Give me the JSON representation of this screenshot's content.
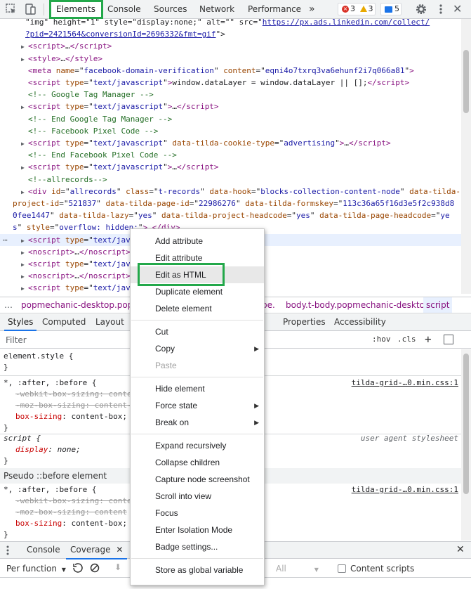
{
  "toolbar": {
    "tabs": [
      {
        "label": "Elements",
        "active": true
      },
      {
        "label": "Console"
      },
      {
        "label": "Sources"
      },
      {
        "label": "Network"
      },
      {
        "label": "Performance"
      }
    ],
    "more_tabs": "»",
    "errors": "3",
    "warnings": "3",
    "messages": "5",
    "icons": [
      "inspect-icon",
      "device-toolbar-icon",
      "settings-gear-icon",
      "more-vertical-icon"
    ]
  },
  "dom": {
    "lines": [
      {
        "html": "<span class='txt'>  \"img\" height=\"1\" style=\"display:none;\" alt=\"\" src=\"</span><span class='link'>https://px.ads.linkedin.com/collect/</span>"
      },
      {
        "html": "<span class='link'>?pid=2421564&amp;conversionId=2696332&amp;fmt=gif</span><span class='txt'>\"&gt;</span>"
      },
      {
        "html": "<span class='arrow'>▶</span><span class='tag'>&lt;script&gt;</span>…<span class='tag'>&lt;/script&gt;</span>"
      },
      {
        "html": "<span class='arrow'>▶</span><span class='tag'>&lt;style&gt;</span>…<span class='tag'>&lt;/style&gt;</span>"
      },
      {
        "html": "<span class='arrow'></span><span class='tag'>&lt;meta</span> <span class='attr'>name</span>=\"<span class='val'>facebook-domain-verification</span>\" <span class='attr'>content</span>=\"<span class='val'>eqni4o7txrq3va6ehunf2i7q066a81</span>\"<span class='tag'>&gt;</span>"
      },
      {
        "html": "<span class='arrow'></span><span class='tag'>&lt;script</span> <span class='attr'>type</span>=\"<span class='val'>text/javascript</span>\"<span class='tag'>&gt;</span>window.dataLayer = window.dataLayer || [];<span class='tag'>&lt;/script&gt;</span>"
      },
      {
        "html": "<span class='arrow'></span><span class='cmt'>&lt;!-- Google Tag Manager --&gt;</span>"
      },
      {
        "html": "<span class='arrow'>▶</span><span class='tag'>&lt;script</span> <span class='attr'>type</span>=\"<span class='val'>text/javascript</span>\"<span class='tag'>&gt;</span>…<span class='tag'>&lt;/script&gt;</span>"
      },
      {
        "html": "<span class='arrow'></span><span class='cmt'>&lt;!-- End Google Tag Manager --&gt;</span>"
      },
      {
        "html": "<span class='arrow'></span><span class='cmt'>&lt;!-- Facebook Pixel Code --&gt;</span>"
      },
      {
        "html": "<span class='arrow'>▶</span><span class='tag'>&lt;script</span> <span class='attr'>type</span>=\"<span class='val'>text/javascript</span>\" <span class='attr'>data-tilda-cookie-type</span>=\"<span class='val'>advertising</span>\"<span class='tag'>&gt;</span>…<span class='tag'>&lt;/script&gt;</span>"
      },
      {
        "html": "<span class='arrow'></span><span class='cmt'>&lt;!-- End Facebook Pixel Code --&gt;</span>"
      },
      {
        "html": "<span class='arrow'>▶</span><span class='tag'>&lt;script</span> <span class='attr'>type</span>=\"<span class='val'>text/javascript</span>\"<span class='tag'>&gt;</span>…<span class='tag'>&lt;/script&gt;</span>"
      },
      {
        "html": "<span class='arrow'></span><span class='cmt'>&lt;!--allrecords--&gt;</span>"
      },
      {
        "html": "<span class='arrow'>▶</span><span class='tag'>&lt;div</span> <span class='attr'>id</span>=\"<span class='val'>allrecords</span>\" <span class='attr'>class</span>=\"<span class='val'>t-records</span>\" <span class='attr'>data-hook</span>=\"<span class='val'>blocks-collection-content-node</span>\" <span class='attr'>data-tilda-</span>"
      },
      {
        "html": "<span class='attr'>project-id</span>=\"<span class='val'>521837</span>\" <span class='attr'>data-tilda-page-id</span>=\"<span class='val'>22986276</span>\" <span class='attr'>data-tilda-formskey</span>=\"<span class='val'>113c36a65f16d3e5f2c938d8</span>"
      },
      {
        "html": "<span class='val'>0fee1447</span>\" <span class='attr'>data-tilda-lazy</span>=\"<span class='val'>yes</span>\" <span class='attr'>data-tilda-project-headcode</span>=\"<span class='val'>yes</span>\" <span class='attr'>data-tilda-page-headcode</span>=\"<span class='val'>ye</span>"
      },
      {
        "html": "<span class='val'>s</span>\" <span class='attr'>style</span>=\"<span class='val'>overflow: hidden;</span>\"<span class='tag'>&gt;</span>…<span class='tag'>&lt;/div&gt;</span>"
      },
      {
        "html": "<span class='arrow'>▶</span><span class='tag'>&lt;script</span> <span class='attr'>type</span>=\"<span class='val'>text/jav</span>",
        "selected": true
      },
      {
        "html": "<span class='arrow'>▶</span><span class='tag'>&lt;noscript&gt;</span>…<span class='tag'>&lt;/noscript&gt;</span>"
      },
      {
        "html": "<span class='arrow'>▶</span><span class='tag'>&lt;script</span> <span class='attr'>type</span>=\"<span class='val'>text/jav</span>"
      },
      {
        "html": "<span class='arrow'>▶</span><span class='tag'>&lt;noscript&gt;</span>…<span class='tag'>&lt;/noscript&gt;</span>"
      },
      {
        "html": "<span class='arrow'>▶</span><span class='tag'>&lt;script</span> <span class='attr'>type</span>=\"<span class='val'>text/jav</span>"
      },
      {
        "html": "<span class='arrow'>▶</span><span class='tag'>&lt;noscript&gt;</span>…<span class='tag'>&lt;/noscript&gt;</span>"
      }
    ]
  },
  "breadcrumb": {
    "ellipsis": "…",
    "left": "popmechanic-desktop.popme",
    "middle": "pe.",
    "body": "body.t-body.popmechanic-desktop",
    "script": "script"
  },
  "styles_tabs": [
    "Styles",
    "Computed",
    "Layout",
    "Properties",
    "Accessibility"
  ],
  "filter": {
    "placeholder": "Filter",
    "hov": ":hov",
    "cls": ".cls",
    "plus": "+"
  },
  "rules": {
    "element_style": "element.style {",
    "close": "}",
    "universal_selector": "*, :after, :before {",
    "webkit_box": "-webkit-box-sizing: conte",
    "moz_box": "-moz-box-sizing: content-",
    "box_sizing_prop": "box-sizing",
    "box_sizing_val": "content-box;",
    "src_tilda": "tilda-grid-…0.min.css:1",
    "script_selector": "script {",
    "display_prop": "display",
    "display_val": "none;",
    "src_ua": "user agent stylesheet",
    "pseudo_header": "Pseudo ::before element",
    "webkit_box2": "-webkit-box-sizing: content",
    "moz_box2": "-moz-box-sizing: content"
  },
  "drawer": {
    "tabs": [
      "Console",
      "Coverage"
    ],
    "toolbar": {
      "per_function": "Per function",
      "all": "All",
      "content_scripts": "Content scripts"
    }
  },
  "context_menu": {
    "items": [
      {
        "label": "Add attribute"
      },
      {
        "label": "Edit attribute"
      },
      {
        "label": "Edit as HTML",
        "hover": true
      },
      {
        "label": "Duplicate element"
      },
      {
        "label": "Delete element"
      },
      {
        "sep": true
      },
      {
        "label": "Cut"
      },
      {
        "label": "Copy",
        "submenu": true
      },
      {
        "label": "Paste",
        "disabled": true
      },
      {
        "sep": true
      },
      {
        "label": "Hide element"
      },
      {
        "label": "Force state",
        "submenu": true
      },
      {
        "label": "Break on",
        "submenu": true
      },
      {
        "sep": true
      },
      {
        "label": "Expand recursively"
      },
      {
        "label": "Collapse children"
      },
      {
        "label": "Capture node screenshot"
      },
      {
        "label": "Scroll into view"
      },
      {
        "label": "Focus"
      },
      {
        "label": "Enter Isolation Mode"
      },
      {
        "label": "Badge settings..."
      },
      {
        "sep": true
      },
      {
        "label": "Store as global variable"
      }
    ]
  },
  "colors": {
    "highlight_green": "#23a84a",
    "selected_row": "#e8f0fe",
    "tag": "#881280",
    "attr": "#994500",
    "value": "#1a1aa6",
    "comment": "#236e25"
  }
}
